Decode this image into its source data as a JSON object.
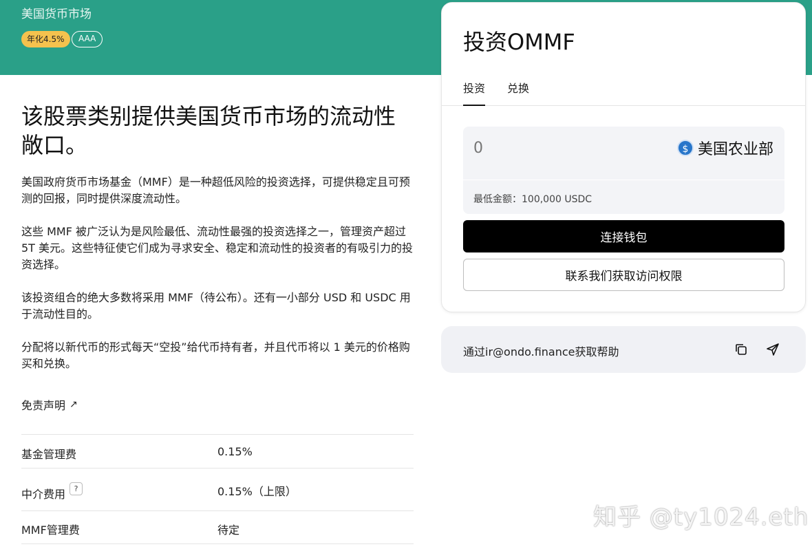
{
  "hero": {
    "subtitle": "美国货币市场",
    "yield_badge": "年化4.5%",
    "rating_badge": "AAA"
  },
  "content": {
    "headline": "该股票类别提供美国货币市场的流动性敞口。",
    "paragraphs": [
      "美国政府货币市场基金（MMF）是一种超低风险的投资选择，可提供稳定且可预测的回报，同时提供深度流动性。",
      "这些 MMF 被广泛认为是风险最低、流动性最强的投资选择之一，管理资产超过 5T 美元。这些特征使它们成为寻求安全、稳定和流动性的投资者的有吸引力的投资选择。",
      "该投资组合的绝大多数将采用 MMF（待公布）。还有一小部分 USD 和 USDC 用于流动性目的。",
      "分配将以新代币的形式每天“空投”给代币持有者，并且代币将以 1 美元的价格购买和兑换。"
    ],
    "disclaimer_link": "免责声明",
    "disclaimer_icon": "external-arrow-icon"
  },
  "fees": [
    {
      "label": "基金管理费",
      "value": "0.15%"
    },
    {
      "label": "中介费用",
      "value": "0.15%（上限）",
      "help": "?"
    },
    {
      "label": "MMF管理费",
      "value": "待定"
    }
  ],
  "invest_card": {
    "title": "投资OMMF",
    "tabs": [
      {
        "label": "投资",
        "active": true
      },
      {
        "label": "兑换",
        "active": false
      }
    ],
    "amount_placeholder": "0",
    "asset_label": "美国农业部",
    "asset_icon": "usdc-coin-icon",
    "min_amount": "最低金额：100,000 USDC",
    "connect_button": "连接钱包",
    "contact_button": "联系我们获取访问权限"
  },
  "help": {
    "text": "通过ir@ondo.finance获取帮助",
    "copy_icon": "copy-icon",
    "send_icon": "send-icon"
  },
  "watermark": "知乎 @ty1024.eth",
  "colors": {
    "hero_bg": "#2aa088",
    "yield_badge": "#f4c24e",
    "primary_button": "#000000",
    "input_bg": "#f3f4f7",
    "usdc_blue": "#2775ca"
  }
}
